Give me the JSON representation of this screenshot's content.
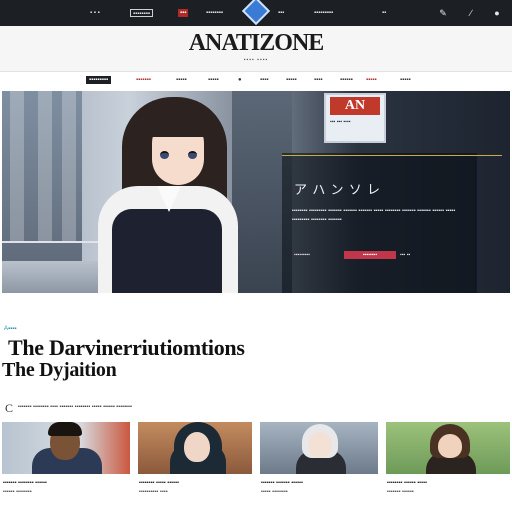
{
  "topbar": {
    "links": [
      "▪ ▪ ▪",
      "▪▪▪▪▪▪▪▪",
      "▪▪▪",
      "▪▪▪▪▪▪▪▪",
      "▪▪▪",
      "▪▪▪▪▪▪▪▪▪",
      "▪▪"
    ],
    "icons": [
      "pencil-icon",
      "brush-icon",
      "user-icon"
    ]
  },
  "masthead": {
    "brand": "ANATIZONE",
    "sub": "▪▪▪▪ ▪▪▪▪"
  },
  "nav": {
    "items": [
      "▪▪▪▪▪▪▪▪▪",
      "▪▪▪▪▪▪▪",
      "▪▪▪▪▪",
      "▪▪▪▪▪",
      "▪▪▪",
      "●",
      "▪▪▪▪",
      "▪▪▪▪▪",
      "▪▪▪▪",
      "▪▪▪▪▪▪",
      "▪▪▪▪▪",
      "▪▪▪▪▪"
    ]
  },
  "hero": {
    "sign_big": "AN",
    "sign_small": "▪▪▪ ▪▪▪ ▪▪▪▪",
    "title": "ア ハ ン ソ レ",
    "body": "▪▪▪▪▪▪▪▪ ▪▪▪▪▪▪▪▪▪ ▪▪▪▪▪▪▪ ▪▪▪▪▪▪▪ ▪▪▪▪▪▪▪ ▪▪▪▪▪ ▪▪▪▪▪▪▪▪ ▪▪▪▪▪▪▪ ▪▪▪▪▪▪▪ ▪▪▪▪▪▪ ▪▪▪▪▪ ▪▪▪▪▪▪▪▪▪ ▪▪▪▪▪▪▪▪ ▪▪▪▪▪▪▪",
    "meta_left": "▪▪▪▪▪▪▪▪▪",
    "cta": "▪▪▪▪▪▪▪▪",
    "meta_right": "▪▪▪ ▪▪"
  },
  "article": {
    "section": "A▪▪▪▪",
    "headline_1": "The Darvinerriutiomtions",
    "headline_2": "The Dyjaition",
    "byline_mark": "C",
    "byline": "▪▪▪▪▪▪▪ ▪▪▪▪▪▪▪▪ ▪▪▪▪ ▪▪▪▪▪▪▪ ▪▪▪▪▪▪▪▪ ▪▪▪▪▪ ▪▪▪▪▪▪ ▪▪▪▪▪▪▪▪"
  },
  "cards": [
    {
      "caption": "▪▪▪▪▪▪▪ ▪▪▪▪▪▪▪▪ ▪▪▪▪▪▪",
      "sub": "▪▪▪▪▪▪ ▪▪▪▪▪▪▪▪"
    },
    {
      "caption": "▪▪▪▪▪▪▪▪ ▪▪▪▪▪ ▪▪▪▪▪▪",
      "sub": "▪▪▪▪▪▪▪▪▪▪ ▪▪▪▪"
    },
    {
      "caption": "▪▪▪▪▪▪▪ ▪▪▪▪▪▪▪ ▪▪▪▪▪▪",
      "sub": "▪▪▪▪▪ ▪▪▪▪▪▪▪▪"
    },
    {
      "caption": "▪▪▪▪▪▪▪▪ ▪▪▪▪▪▪ ▪▪▪▪▪",
      "sub": "▪▪▪▪▪▪▪ ▪▪▪▪▪▪"
    }
  ],
  "colors": {
    "topbar_bg": "#1c1f24",
    "accent_red": "#c0364a",
    "accent_blue": "#3a7bd5",
    "section_label": "#2a8fb5"
  }
}
